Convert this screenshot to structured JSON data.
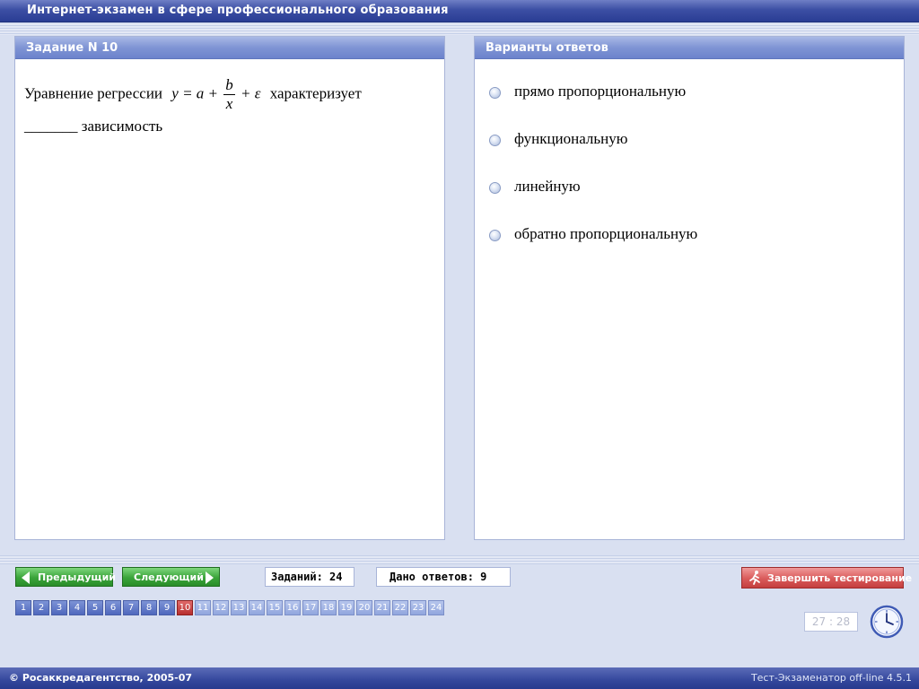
{
  "window": {
    "title": "Интернет-экзамен в сфере профессионального образования"
  },
  "task_panel": {
    "header": "Задание N 10",
    "question": {
      "before_formula": "Уравнение регрессии",
      "formula": {
        "lhs": "y = a +",
        "numerator": "b",
        "denominator": "x",
        "rhs": "+ ε"
      },
      "after_formula": "характеризует",
      "line2": "_______ зависимость"
    }
  },
  "answers_panel": {
    "header": "Варианты ответов",
    "options": [
      {
        "label": "прямо пропорциональную",
        "selected": false
      },
      {
        "label": "функциональную",
        "selected": false
      },
      {
        "label": "линейную",
        "selected": false
      },
      {
        "label": "обратно пропорциональную",
        "selected": false
      }
    ]
  },
  "navigation": {
    "prev_label": "Предыдущий",
    "next_label": "Следующий",
    "tasks_count_text": "Заданий: 24",
    "answered_count_text": "Дано ответов: 9",
    "finish_label": "Завершить тестирование",
    "current_question": 10,
    "questions": [
      {
        "n": "1",
        "status": "answered"
      },
      {
        "n": "2",
        "status": "answered"
      },
      {
        "n": "3",
        "status": "answered"
      },
      {
        "n": "4",
        "status": "answered"
      },
      {
        "n": "5",
        "status": "answered"
      },
      {
        "n": "6",
        "status": "answered"
      },
      {
        "n": "7",
        "status": "answered"
      },
      {
        "n": "8",
        "status": "answered"
      },
      {
        "n": "9",
        "status": "answered"
      },
      {
        "n": "10",
        "status": "current"
      },
      {
        "n": "11",
        "status": "unanswered"
      },
      {
        "n": "12",
        "status": "unanswered"
      },
      {
        "n": "13",
        "status": "unanswered"
      },
      {
        "n": "14",
        "status": "unanswered"
      },
      {
        "n": "15",
        "status": "unanswered"
      },
      {
        "n": "16",
        "status": "unanswered"
      },
      {
        "n": "17",
        "status": "unanswered"
      },
      {
        "n": "18",
        "status": "unanswered"
      },
      {
        "n": "19",
        "status": "unanswered"
      },
      {
        "n": "20",
        "status": "unanswered"
      },
      {
        "n": "21",
        "status": "unanswered"
      },
      {
        "n": "22",
        "status": "unanswered"
      },
      {
        "n": "23",
        "status": "unanswered"
      },
      {
        "n": "24",
        "status": "unanswered"
      }
    ]
  },
  "timer": {
    "value": "27 : 28",
    "icon": "clock-icon"
  },
  "footer": {
    "copyright": "© Росаккредагентство, 2005-07",
    "version": "Тест-Экзаменатор off-line 4.5.1"
  },
  "colors": {
    "titlebar": "#3c4fa4",
    "panel_header": "#7f94d4",
    "nav_button": "#3aa43a",
    "finish_button": "#d95a5a",
    "current_question": "#b72f2f",
    "background": "#d9e0f1"
  }
}
